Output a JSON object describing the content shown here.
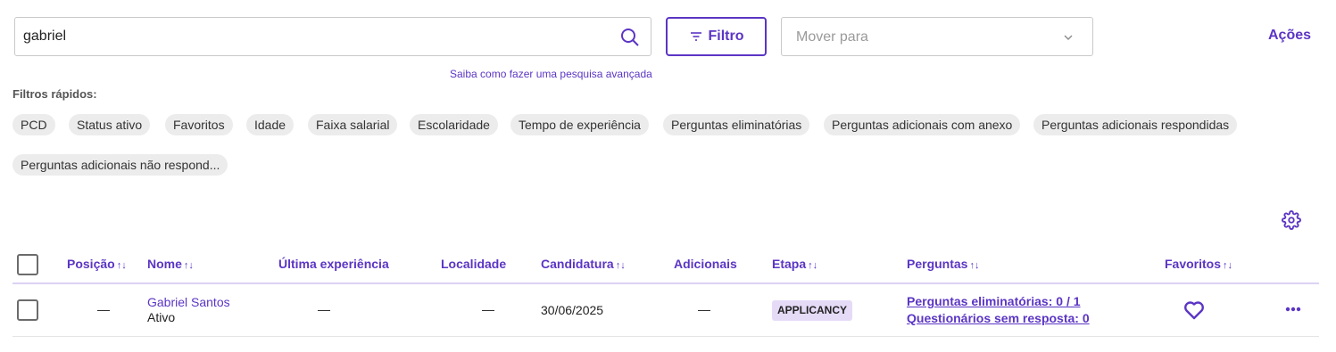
{
  "search": {
    "value": "gabriel",
    "icon": "search-icon",
    "advanced_link": "Saiba como fazer uma pesquisa avançada"
  },
  "filter_button": {
    "label": "Filtro",
    "icon": "filter-icon"
  },
  "move_select": {
    "placeholder": "Mover para",
    "icon": "chevron-down-icon"
  },
  "actions_label": "Ações",
  "quick_filters": {
    "title": "Filtros rápidos:",
    "chips": [
      "PCD",
      "Status ativo",
      "Favoritos",
      "Idade",
      "Faixa salarial",
      "Escolaridade",
      "Tempo de experiência",
      "Perguntas eliminatórias",
      "Perguntas adicionais com anexo",
      "Perguntas adicionais respondidas",
      "Perguntas adicionais não respond..."
    ]
  },
  "table": {
    "columns": [
      "Posição",
      "Nome",
      "Última experiência",
      "Localidade",
      "Candidatura",
      "Adicionais",
      "Etapa",
      "Perguntas",
      "Favoritos"
    ],
    "rows": [
      {
        "position": "—",
        "name": "Gabriel Santos",
        "status": "Ativo",
        "last_experience": "—",
        "location": "—",
        "application_date": "30/06/2025",
        "additional": "—",
        "stage": "APPLICANCY",
        "questions_eliminatory": "Perguntas eliminatórias: 0 / 1",
        "questions_unanswered": "Questionários sem resposta: 0"
      }
    ]
  },
  "colors": {
    "accent": "#5b35c4",
    "chip_bg": "#ececec",
    "badge_bg": "#e6dbf7"
  }
}
